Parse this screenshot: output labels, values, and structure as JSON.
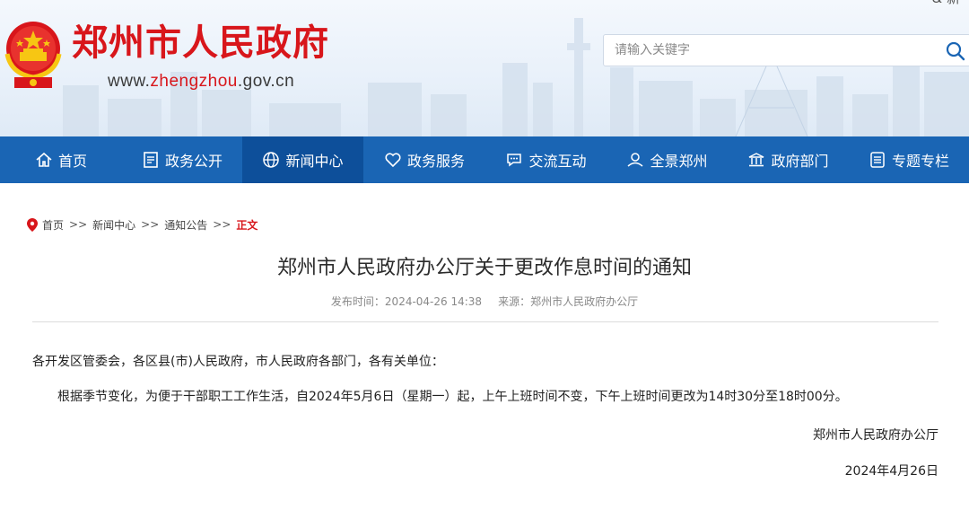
{
  "header": {
    "site_title": "郑州市人民政府",
    "url_prefix": "www.",
    "url_highlight": "zhengzhou",
    "url_suffix": ".gov.cn",
    "top_link": "&  新",
    "search": {
      "placeholder": "请输入关键字"
    },
    "colors": {
      "brand_red": "#d8161b",
      "nav_blue": "#1a65b4",
      "nav_active": "#0d4f9a"
    }
  },
  "nav": {
    "items": [
      {
        "label": "首页",
        "icon": "home-icon"
      },
      {
        "label": "政务公开",
        "icon": "document-icon"
      },
      {
        "label": "新闻中心",
        "icon": "globe-icon",
        "active": true
      },
      {
        "label": "政务服务",
        "icon": "heart-icon"
      },
      {
        "label": "交流互动",
        "icon": "chat-icon"
      },
      {
        "label": "全景郑州",
        "icon": "panorama-icon"
      },
      {
        "label": "政府部门",
        "icon": "building-icon"
      },
      {
        "label": "专题专栏",
        "icon": "list-icon"
      }
    ]
  },
  "breadcrumb": {
    "items": [
      "首页",
      "新闻中心",
      "通知公告"
    ],
    "separator": ">>",
    "current": "正文"
  },
  "article": {
    "title": "郑州市人民政府办公厅关于更改作息时间的通知",
    "publish_label": "发布时间：",
    "publish_time": "2024-04-26 14:38",
    "source_label": "来源：",
    "source": "郑州市人民政府办公厅",
    "salutation": "各开发区管委会，各区县(市)人民政府，市人民政府各部门，各有关单位：",
    "body": "根据季节变化，为便于干部职工工作生活，自2024年5月6日（星期一）起，上午上班时间不变，下午上班时间更改为14时30分至18时00分。",
    "signature": "郑州市人民政府办公厅",
    "date": "2024年4月26日"
  }
}
